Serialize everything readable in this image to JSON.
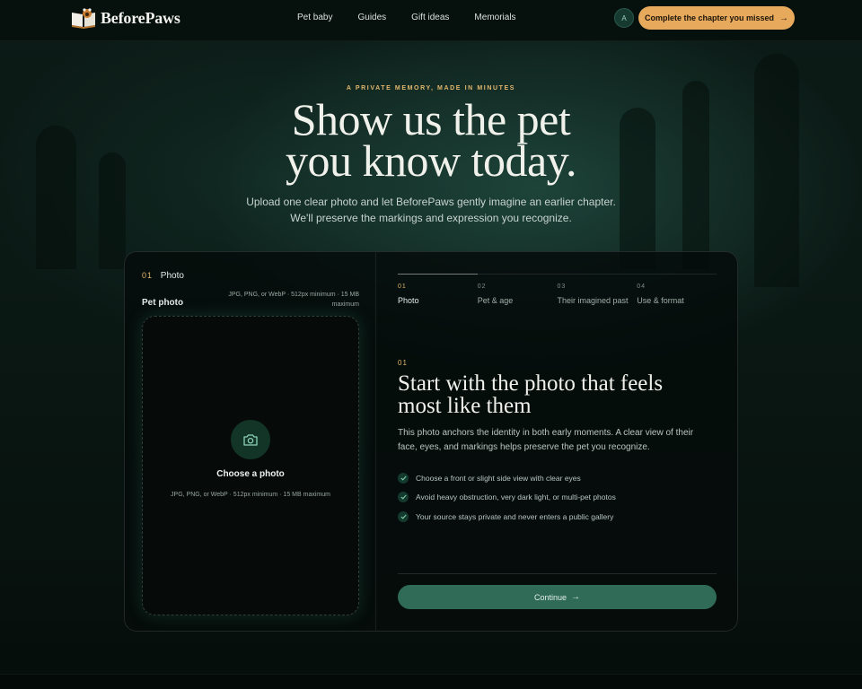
{
  "brand": {
    "name": "BeforePaws"
  },
  "nav": {
    "links": [
      "Pet baby",
      "Guides",
      "Gift ideas",
      "Memorials"
    ],
    "avatar_initial": "A",
    "cta_label": "Complete the chapter you missed",
    "cta_arrow": "→"
  },
  "hero": {
    "eyebrow": "A PRIVATE MEMORY, MADE IN MINUTES",
    "headline_line1": "Show us the pet",
    "headline_line2": "you know today.",
    "subhead_line1": "Upload one clear photo and let BeforePaws gently imagine an earlier chapter.",
    "subhead_line2": "We'll preserve the markings and expression you recognize."
  },
  "upload": {
    "step_num": "01",
    "step_label": "Photo",
    "field_label": "Pet photo",
    "field_hint": "JPG, PNG, or WebP · 512px minimum · 15 MB maximum",
    "choose_label": "Choose a photo",
    "choose_hint": "JPG, PNG, or WebP · 512px minimum · 15 MB maximum"
  },
  "steps": [
    {
      "num": "01",
      "label": "Photo"
    },
    {
      "num": "02",
      "label": "Pet & age"
    },
    {
      "num": "03",
      "label": "Their imagined past"
    },
    {
      "num": "04",
      "label": "Use & format"
    }
  ],
  "panel": {
    "num": "01",
    "title": "Start with the photo that feels most like them",
    "description": "This photo anchors the identity in both early moments. A clear view of their face, eyes, and markings helps preserve the pet you recognize.",
    "checks": [
      "Choose a front or slight side view with clear eyes",
      "Avoid heavy obstruction, very dark light, or multi-pet photos",
      "Your source stays private and never enters a public gallery"
    ],
    "continue_label": "Continue",
    "continue_arrow": "→"
  },
  "colors": {
    "accent": "#e7aa5c",
    "primary_button": "#2f6b57",
    "background": "#0b1915"
  }
}
